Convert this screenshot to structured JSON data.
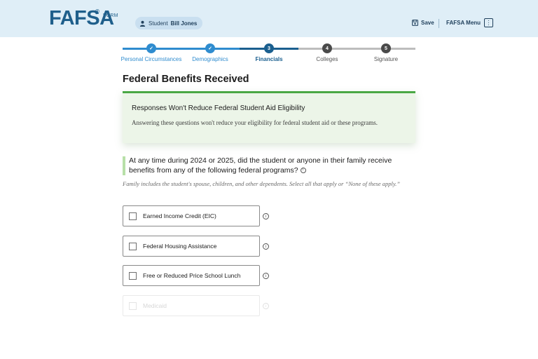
{
  "header": {
    "logo_text": "FAFSA",
    "logo_reg": "®",
    "logo_sub": "FORM",
    "student_prefix": "Student",
    "student_name": "Bill Jones",
    "save_label": "Save",
    "menu_label": "FAFSA Menu"
  },
  "progress": {
    "steps": [
      {
        "label": "Personal Circumstances",
        "state": "complete",
        "number": "✓"
      },
      {
        "label": "Demographics",
        "state": "complete",
        "number": "✓"
      },
      {
        "label": "Financials",
        "state": "current",
        "number": "3"
      },
      {
        "label": "Colleges",
        "state": "upcoming",
        "number": "4"
      },
      {
        "label": "Signature",
        "state": "upcoming",
        "number": "5"
      }
    ]
  },
  "page": {
    "title": "Federal Benefits Received"
  },
  "callout": {
    "title": "Responses Won't Reduce Federal Student Aid Eligibility",
    "body": "Answering these questions won't reduce your eligibility for federal student aid or these programs."
  },
  "question": {
    "text": "At any time during 2024 or 2025, did the student or anyone in their family receive benefits from any of the following federal programs?",
    "info_glyph": "i",
    "hint": "Family includes the student's spouse, children, and other dependents. Select all that apply or “None of these apply.”"
  },
  "options": [
    {
      "label": "Earned Income Credit (EIC)",
      "checked": false
    },
    {
      "label": "Federal Housing Assistance",
      "checked": false
    },
    {
      "label": "Free or Reduced Price School Lunch",
      "checked": false
    },
    {
      "label": "Medicaid",
      "checked": false
    }
  ],
  "colors": {
    "header_bg": "#dfeef7",
    "brand_blue": "#1f5f8b",
    "step_complete": "#2f8ccf",
    "step_current": "#1a5f8f",
    "step_upcoming": "#4a4a4a",
    "callout_accent": "#4aa845",
    "callout_bg": "#ecf5e8"
  }
}
